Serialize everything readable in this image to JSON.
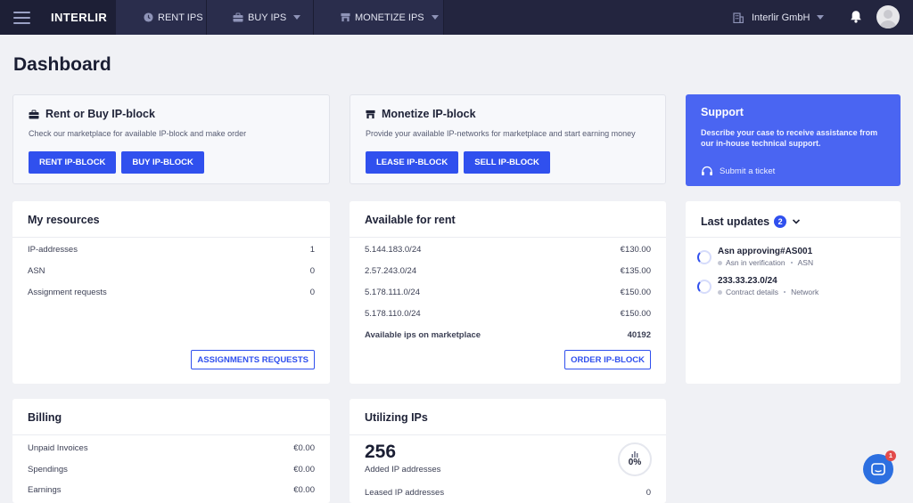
{
  "brand": "INTERLIR",
  "nav": [
    {
      "label": "RENT IPS",
      "icon": "clock-icon"
    },
    {
      "label": "BUY IPS",
      "icon": "briefcase-icon"
    },
    {
      "label": "MONETIZE IPS",
      "icon": "store-icon"
    }
  ],
  "account": {
    "company": "Interlir GmbH"
  },
  "page_title": "Dashboard",
  "rent_buy": {
    "title": "Rent or Buy IP-block",
    "desc": "Check our marketplace for available IP-block and make order",
    "btn_rent": "RENT IP-BLOCK",
    "btn_buy": "BUY IP-BLOCK"
  },
  "monetize": {
    "title": "Monetize IP-block",
    "desc": "Provide your available IP-networks for marketplace and start earning money",
    "btn_lease": "LEASE IP-BLOCK",
    "btn_sell": "SELL IP-BLOCK"
  },
  "support": {
    "title": "Support",
    "desc": "Describe your case to receive assistance from our in-house technical support.",
    "ticket": "Submit a ticket"
  },
  "resources": {
    "title": "My resources",
    "rows": [
      {
        "label": "IP-addresses",
        "value": "1"
      },
      {
        "label": "ASN",
        "value": "0"
      },
      {
        "label": "Assignment requests",
        "value": "0"
      }
    ],
    "button": "ASSIGNMENTS REQUESTS"
  },
  "rent": {
    "title": "Available for rent",
    "rows": [
      {
        "label": "5.144.183.0/24",
        "value": "€130.00"
      },
      {
        "label": "2.57.243.0/24",
        "value": "€135.00"
      },
      {
        "label": "5.178.111.0/24",
        "value": "€150.00"
      },
      {
        "label": "5.178.110.0/24",
        "value": "€150.00"
      }
    ],
    "total_label": "Available ips on marketplace",
    "total_value": "40192",
    "button": "ORDER IP-BLOCK"
  },
  "updates": {
    "title": "Last updates",
    "count": "2",
    "items": [
      {
        "title": "Asn approving#AS001",
        "status": "Asn in verification",
        "type": "ASN"
      },
      {
        "title": "233.33.23.0/24",
        "status": "Contract details",
        "type": "Network"
      }
    ]
  },
  "billing": {
    "title": "Billing",
    "rows": [
      {
        "label": "Unpaid Invoices",
        "value": "€0.00"
      },
      {
        "label": "Spendings",
        "value": "€0.00"
      },
      {
        "label": "Earnings",
        "value": "€0.00"
      }
    ]
  },
  "utilizing": {
    "title": "Utilizing IPs",
    "added_value": "256",
    "added_label": "Added IP addresses",
    "percent": "0%",
    "leased_label": "Leased IP addresses",
    "leased_value": "0"
  },
  "chat": {
    "count": "1"
  },
  "colors": {
    "accent": "#3050ee",
    "topbar": "#23253f",
    "support": "#4a65f2"
  }
}
